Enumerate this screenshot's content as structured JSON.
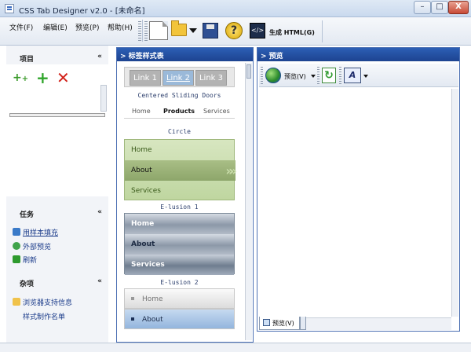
{
  "window": {
    "title": "CSS Tab Designer v2.0 - [未命名]",
    "min_label": "–",
    "max_label": "□",
    "close_label": "X"
  },
  "menu": {
    "file": "文件(F)",
    "edit": "编辑(E)",
    "preview": "预览(P)",
    "help": "帮助(H)"
  },
  "toolbar": {
    "help_glyph": "?",
    "generate_glyph": "</>",
    "generate_label": "生成 HTML(G)"
  },
  "left": {
    "project_header": "项目",
    "tasks_header": "任务",
    "tasks": [
      "用样本填充",
      "外部预览",
      "刷新"
    ],
    "misc_header": "杂项",
    "misc": [
      "浏览器支持信息",
      "样式制作名单"
    ],
    "collapse_glyph": "«"
  },
  "center": {
    "header": "> 标签样式表",
    "tabs1": [
      "Link 1",
      "Link 2",
      "Link 3"
    ],
    "sliding_title": "Centered Sliding Doors",
    "sliding_tabs": [
      "Home",
      "Products",
      "Services"
    ],
    "circle_title": "Circle",
    "circle_items": [
      "Home",
      "About",
      "Services"
    ],
    "elusion1_title": "E-lusion 1",
    "elusion1_items": [
      "Home",
      "About",
      "Services"
    ],
    "elusion2_title": "E-lusion 2",
    "elusion2_items": [
      "Home",
      "About"
    ]
  },
  "right": {
    "header": "> 预览",
    "preview_label": "预览(V)",
    "refresh_glyph": "↻",
    "font_glyph": "A",
    "bottom_tab": "预览(V)"
  },
  "colors": {
    "panel_header": "#1d4390",
    "circle_green": "#bfd6a0",
    "elusion_grey": "#8c98a8",
    "elusion2_blue": "#93b5dd"
  }
}
